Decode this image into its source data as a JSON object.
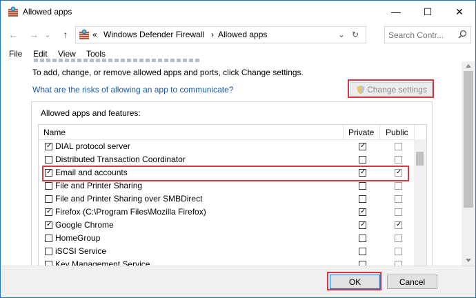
{
  "window": {
    "title": "Allowed apps",
    "minimize": "—",
    "maximize": "☐",
    "close": "✕"
  },
  "address": {
    "back_icon": "←",
    "forward_icon": "→",
    "dropdown_icon": "⌄",
    "up_icon": "↑",
    "separator": "«",
    "crumbs": [
      "Windows Defender Firewall",
      "Allowed apps"
    ],
    "crumb_arrow": "›",
    "addr_dropdown_icon": "⌄",
    "refresh_icon": "↻",
    "search_placeholder": "Search Contr..."
  },
  "menu": [
    "File",
    "Edit",
    "View",
    "Tools"
  ],
  "main": {
    "instructions": "To add, change, or remove allowed apps and ports, click Change settings.",
    "risk_link": "What are the risks of allowing an app to communicate?",
    "change_settings_label": "Change settings",
    "group_title": "Allowed apps and features:",
    "columns": {
      "name": "Name",
      "private": "Private",
      "public": "Public"
    },
    "rows": [
      {
        "name": "DIAL protocol server",
        "checked": true,
        "private": true,
        "public": false
      },
      {
        "name": "Distributed Transaction Coordinator",
        "checked": false,
        "private": false,
        "public": false
      },
      {
        "name": "Email and accounts",
        "checked": true,
        "private": true,
        "public": true
      },
      {
        "name": "File and Printer Sharing",
        "checked": false,
        "private": false,
        "public": false
      },
      {
        "name": "File and Printer Sharing over SMBDirect",
        "checked": false,
        "private": false,
        "public": false
      },
      {
        "name": "Firefox (C:\\Program Files\\Mozilla Firefox)",
        "checked": true,
        "private": true,
        "public": false
      },
      {
        "name": "Google Chrome",
        "checked": true,
        "private": true,
        "public": true
      },
      {
        "name": "HomeGroup",
        "checked": false,
        "private": false,
        "public": false
      },
      {
        "name": "iSCSI Service",
        "checked": false,
        "private": false,
        "public": false
      },
      {
        "name": "Key Management Service",
        "checked": false,
        "private": false,
        "public": false
      }
    ],
    "highlighted_row": "Email and accounts"
  },
  "footer": {
    "ok_label": "OK",
    "cancel_label": "Cancel"
  },
  "colors": {
    "highlight": "#d9363e",
    "link": "#1a5aa8",
    "window_border": "#1d77c5"
  }
}
